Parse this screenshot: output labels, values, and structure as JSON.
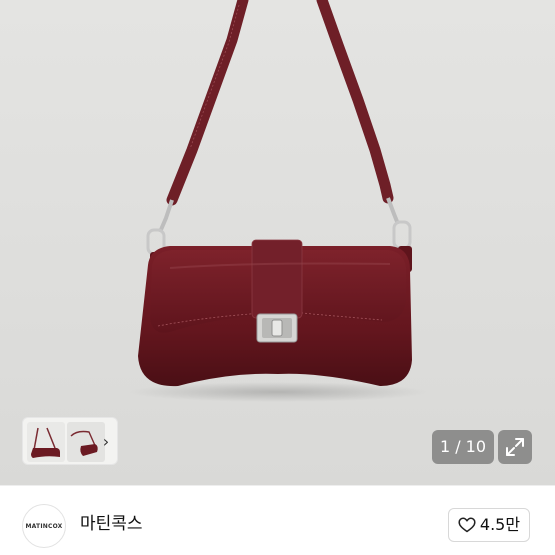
{
  "gallery": {
    "counter": "1 / 10",
    "expand_icon": "expand-arrows-icon",
    "thumb_next_icon": "chevron-right-icon",
    "product_colors": {
      "bag": "#6b1a22",
      "bag_dark": "#4e1016",
      "strap": "#7a2a31",
      "hardware": "#c9c9c9"
    }
  },
  "store": {
    "logo_text": "MATINCOX",
    "name": "마틴콕스",
    "like_icon": "heart-outline-icon",
    "like_count": "4.5만"
  }
}
